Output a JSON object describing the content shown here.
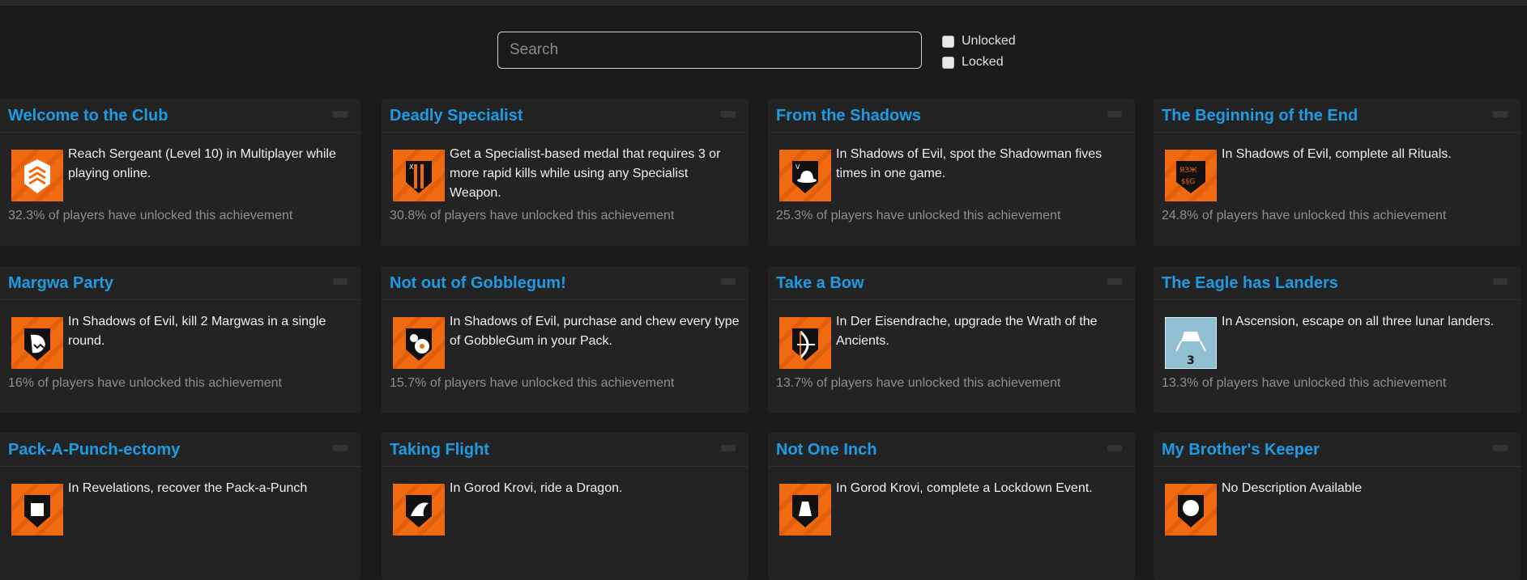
{
  "search": {
    "placeholder": "Search"
  },
  "filters": {
    "unlocked": "Unlocked",
    "locked": "Locked"
  },
  "colors": {
    "accent": "#1f9be3",
    "icon_orange": "#f26a10",
    "icon_blue": "#8fbfd0"
  },
  "achievements": [
    {
      "title": "Welcome to the Club",
      "desc": "Reach Sergeant (Level 10) in Multiplayer while playing online.",
      "stat": "32.3% of players have unlocked this achievement",
      "icon": "chevron-rank-icon",
      "icon_style": "orange"
    },
    {
      "title": "Deadly Specialist",
      "desc": "Get a Specialist-based medal that requires 3 or more rapid kills while using any Specialist Weapon.",
      "stat": "30.8% of players have unlocked this achievement",
      "icon": "specialist-weapon-icon",
      "icon_style": "orange"
    },
    {
      "title": "From the Shadows",
      "desc": "In Shadows of Evil, spot the Shadowman fives times in one game.",
      "stat": "25.3% of players have unlocked this achievement",
      "icon": "shadowman-hat-icon",
      "icon_style": "orange"
    },
    {
      "title": "The Beginning of the End",
      "desc": "In Shadows of Evil, complete all Rituals.",
      "stat": "24.8% of players have unlocked this achievement",
      "icon": "ritual-symbols-icon",
      "icon_style": "orange"
    },
    {
      "title": "Margwa Party",
      "desc": "In Shadows of Evil, kill 2 Margwas in a single round.",
      "stat": "16% of players have unlocked this achievement",
      "icon": "margwa-icon",
      "icon_style": "orange"
    },
    {
      "title": "Not out of Gobblegum!",
      "desc": "In Shadows of Evil, purchase and chew every type of GobbleGum in your Pack.",
      "stat": "15.7% of players have unlocked this achievement",
      "icon": "gobblegum-icon",
      "icon_style": "orange"
    },
    {
      "title": "Take a Bow",
      "desc": "In Der Eisendrache, upgrade the Wrath of the Ancients.",
      "stat": "13.7% of players have unlocked this achievement",
      "icon": "bow-icon",
      "icon_style": "orange"
    },
    {
      "title": "The Eagle has Landers",
      "desc": "In Ascension, escape on all three lunar landers.",
      "stat": "13.3% of players have unlocked this achievement",
      "icon": "lunar-lander-icon",
      "icon_style": "blue",
      "badge": "3"
    },
    {
      "title": "Pack-A-Punch-ectomy",
      "desc": "In Revelations, recover the Pack-a-Punch",
      "stat": "",
      "icon": "pack-a-punch-icon",
      "icon_style": "orange"
    },
    {
      "title": "Taking Flight",
      "desc": "In Gorod Krovi, ride a Dragon.",
      "stat": "",
      "icon": "dragon-icon",
      "icon_style": "orange"
    },
    {
      "title": "Not One Inch",
      "desc": "In Gorod Krovi, complete a Lockdown Event.",
      "stat": "",
      "icon": "lockdown-icon",
      "icon_style": "orange"
    },
    {
      "title": "My Brother's Keeper",
      "desc": "No Description Available",
      "stat": "",
      "icon": "brother-icon",
      "icon_style": "orange"
    }
  ]
}
